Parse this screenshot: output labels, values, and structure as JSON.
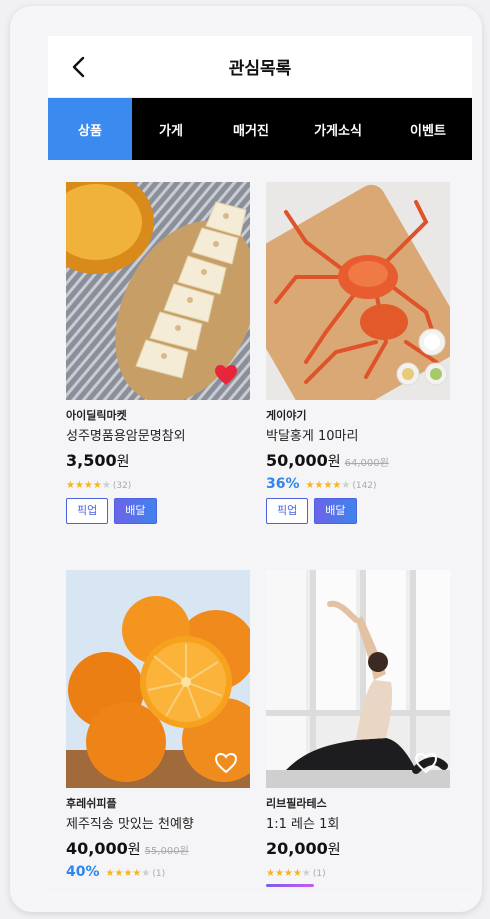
{
  "header": {
    "title": "관심목록"
  },
  "tabs": [
    "상품",
    "가게",
    "매거진",
    "가게소식",
    "이벤트"
  ],
  "active_tab": "상품",
  "products": [
    {
      "store": "아이딜릭마켓",
      "name": "성주명품용암문명참외",
      "price": "3,500",
      "currency": "원",
      "original_price": "",
      "discount": "",
      "rating_stars": 4,
      "review_count": "(32)",
      "badges": [
        "픽업",
        "배달"
      ],
      "liked": true,
      "image": "melon"
    },
    {
      "store": "게이야기",
      "name": "박달홍게 10마리",
      "price": "50,000",
      "currency": "원",
      "original_price": "64,000원",
      "discount": "36%",
      "rating_stars": 4,
      "review_count": "(142)",
      "badges": [
        "픽업",
        "배달"
      ],
      "liked": false,
      "image": "crab"
    },
    {
      "store": "후레쉬피플",
      "name": "제주직송 맛있는 천예향",
      "price": "40,000",
      "currency": "원",
      "original_price": "55,000원",
      "discount": "40%",
      "rating_stars": 4,
      "review_count": "(1)",
      "badges": [],
      "liked": false,
      "image": "orange"
    },
    {
      "store": "리브필라테스",
      "name": "1:1 레슨 1회",
      "price": "20,000",
      "currency": "원",
      "original_price": "",
      "discount": "",
      "rating_stars": 4,
      "review_count": "(1)",
      "badges": [],
      "liked": false,
      "image": "yoga"
    }
  ],
  "colors": {
    "accent_blue": "#3a8af0",
    "tab_bar": "#000000",
    "heart_liked": "#e8263b",
    "star": "#f5b520",
    "discount": "#2f86eb"
  }
}
